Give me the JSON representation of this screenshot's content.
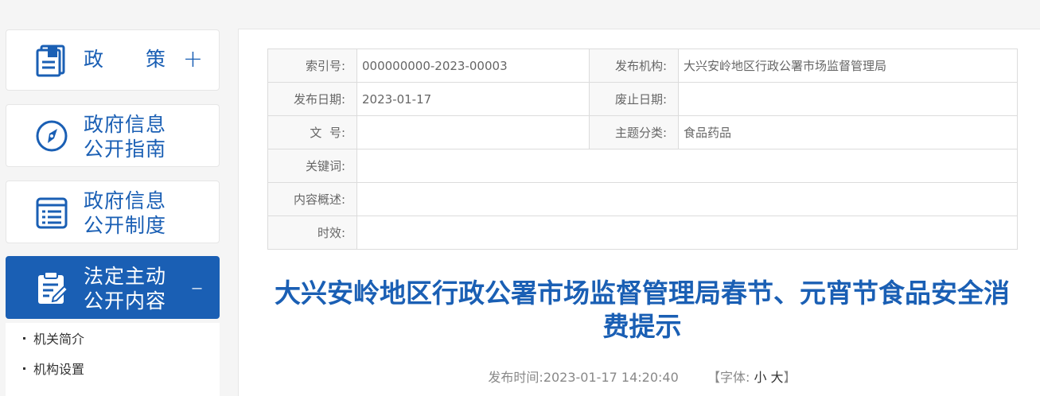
{
  "sidebar": {
    "items": [
      {
        "label": "政　　策",
        "toggle": "+"
      },
      {
        "label": "政府信息\n公开指南"
      },
      {
        "label": "政府信息\n公开制度"
      },
      {
        "label": "法定主动\n公开内容",
        "toggle": "–"
      }
    ],
    "sub_items": [
      "机关简介",
      "机构设置"
    ]
  },
  "meta": {
    "index_label": "索引号:",
    "index_value": "000000000-2023-00003",
    "org_label": "发布机构:",
    "org_value": "大兴安岭地区行政公署市场监督管理局",
    "pub_date_label": "发布日期:",
    "pub_date_value": "2023-01-17",
    "abolish_label": "废止日期:",
    "abolish_value": "",
    "doc_no_label": "文  号:",
    "doc_no_value": "",
    "topic_label": "主题分类:",
    "topic_value": "食品药品",
    "keywords_label": "关键词:",
    "keywords_value": "",
    "summary_label": "内容概述:",
    "summary_value": "",
    "validity_label": "时效:",
    "validity_value": ""
  },
  "article": {
    "title": "大兴安岭地区行政公署市场监督管理局春节、元宵节食品安全消费提示",
    "pub_time_label": "发布时间:",
    "pub_time": "2023-01-17 14:20:40",
    "font_label": "【字体:",
    "font_small": "小",
    "font_large": "大",
    "font_close": "】"
  },
  "colors": {
    "accent": "#1a5fb4"
  },
  "icons": [
    "book-icon",
    "compass-icon",
    "list-icon",
    "clipboard-icon"
  ]
}
